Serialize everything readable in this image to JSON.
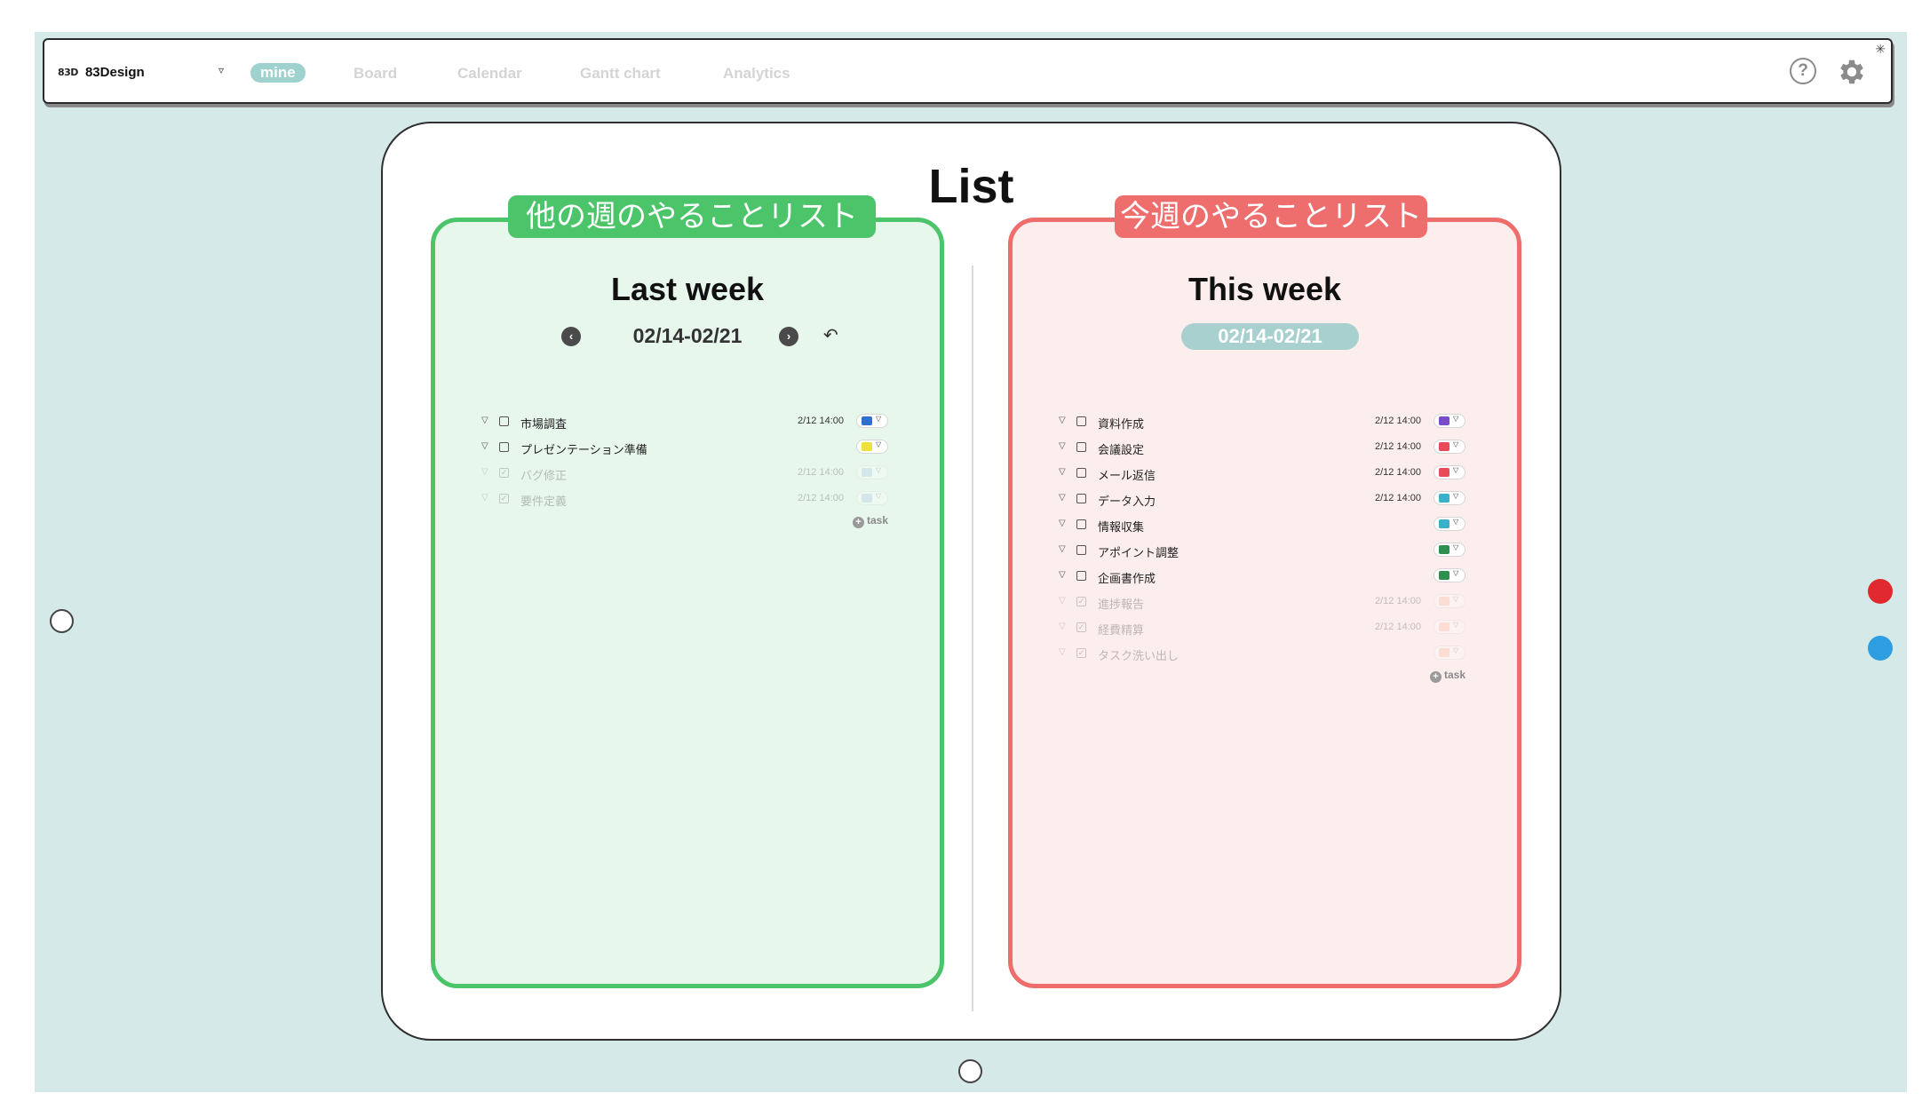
{
  "nav": {
    "logo_mark": "83D",
    "workspace": "83Design",
    "tabs": [
      "mine",
      "Board",
      "Calendar",
      "Gantt chart",
      "Analytics"
    ],
    "active_tab": "mine",
    "help_symbol": "?"
  },
  "board": {
    "title": "List",
    "last_week": {
      "tag": "他の週のやることリスト",
      "heading": "Last week",
      "date_range": "02/14-02/21",
      "prev_symbol": "‹",
      "next_symbol": "›",
      "reset_symbol": "↶",
      "tasks": [
        {
          "name": "市場調査",
          "due": "2/12 14:00",
          "color": "#2f6fd0",
          "done": false
        },
        {
          "name": "プレゼンテーション準備",
          "due": "",
          "color": "#ece23a",
          "done": false
        },
        {
          "name": "バグ修正",
          "due": "2/12 14:00",
          "color": "#9fc0e8",
          "done": true
        },
        {
          "name": "要件定義",
          "due": "2/12 14:00",
          "color": "#9fc0e8",
          "done": true
        }
      ],
      "add_label": "task"
    },
    "this_week": {
      "tag": "今週のやることリスト",
      "heading": "This week",
      "date_range": "02/14-02/21",
      "tasks": [
        {
          "name": "資料作成",
          "due": "2/12 14:00",
          "color": "#7a4cc9",
          "done": false
        },
        {
          "name": "会議設定",
          "due": "2/12 14:00",
          "color": "#e84a57",
          "done": false
        },
        {
          "name": "メール返信",
          "due": "2/12 14:00",
          "color": "#e84a57",
          "done": false
        },
        {
          "name": "データ入力",
          "due": "2/12 14:00",
          "color": "#3bb0c9",
          "done": false
        },
        {
          "name": "情報収集",
          "due": "",
          "color": "#3bb0c9",
          "done": false
        },
        {
          "name": "アポイント調整",
          "due": "",
          "color": "#2f8f4e",
          "done": false
        },
        {
          "name": "企画書作成",
          "due": "",
          "color": "#2f8f4e",
          "done": false
        },
        {
          "name": "進捗報告",
          "due": "2/12 14:00",
          "color": "#f6b38f",
          "done": true
        },
        {
          "name": "経費精算",
          "due": "2/12 14:00",
          "color": "#f6b38f",
          "done": true
        },
        {
          "name": "タスク洗い出し",
          "due": "",
          "color": "#f6b38f",
          "done": true
        }
      ],
      "add_label": "task"
    }
  },
  "colors": {
    "canvas_bg": "#d4e9e8",
    "red_handle": "#e02a2f",
    "blue_handle": "#2f9ee0"
  }
}
